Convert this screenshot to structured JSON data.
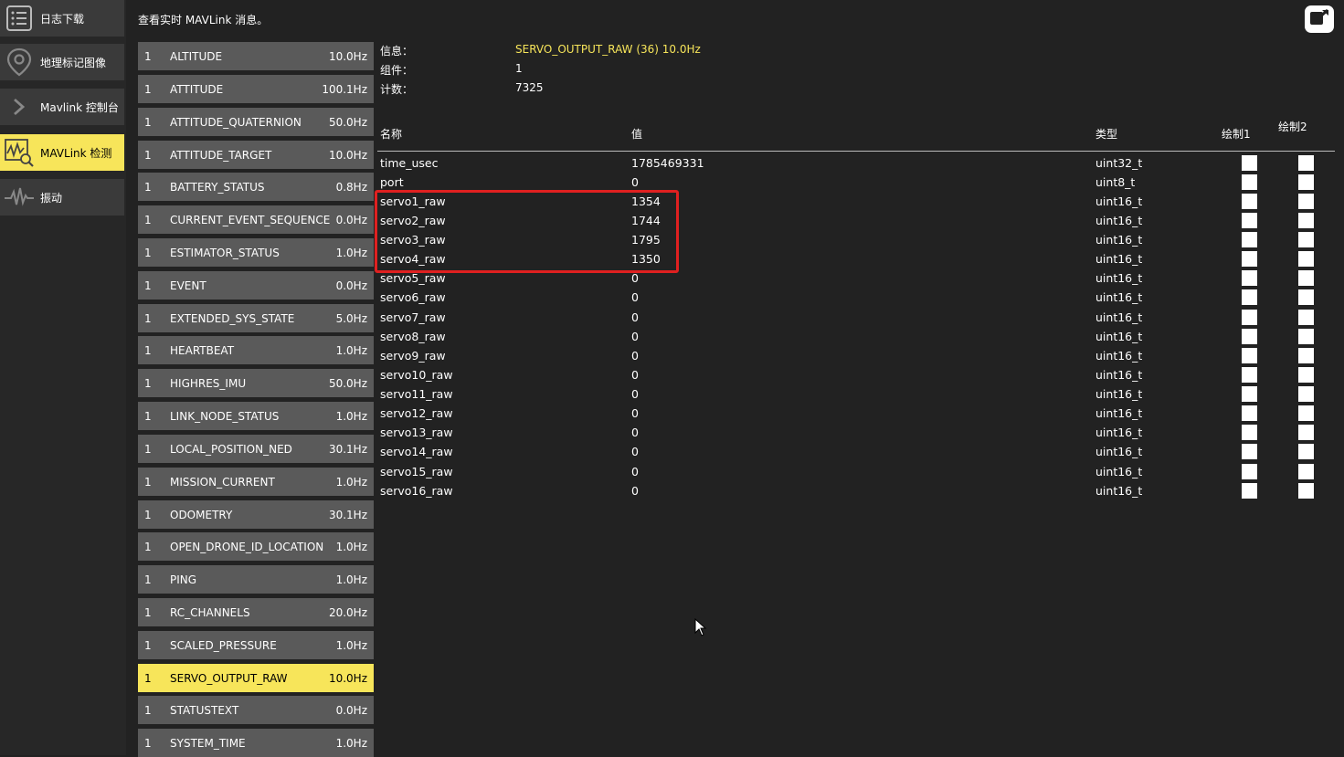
{
  "sidebar": {
    "items": [
      {
        "label": "日志下载",
        "icon": "list-icon",
        "active": false
      },
      {
        "label": "地理标记图像",
        "icon": "map-pin-icon",
        "active": false
      },
      {
        "label": "Mavlink 控制台",
        "icon": "chevron-right-icon",
        "active": false
      },
      {
        "label": "MAVLink 检测",
        "icon": "waveform-search-icon",
        "active": true
      },
      {
        "label": "振动",
        "icon": "vibration-wave-icon",
        "active": false
      }
    ]
  },
  "header": {
    "text": "查看实时 MAVLink 消息。",
    "popout_icon": "popout-window-icon"
  },
  "messages": [
    {
      "comp": "1",
      "name": "ALTITUDE",
      "rate": "10.0Hz"
    },
    {
      "comp": "1",
      "name": "ATTITUDE",
      "rate": "100.1Hz"
    },
    {
      "comp": "1",
      "name": "ATTITUDE_QUATERNION",
      "rate": "50.0Hz"
    },
    {
      "comp": "1",
      "name": "ATTITUDE_TARGET",
      "rate": "10.0Hz"
    },
    {
      "comp": "1",
      "name": "BATTERY_STATUS",
      "rate": "0.8Hz"
    },
    {
      "comp": "1",
      "name": "CURRENT_EVENT_SEQUENCE",
      "rate": "0.0Hz"
    },
    {
      "comp": "1",
      "name": "ESTIMATOR_STATUS",
      "rate": "1.0Hz"
    },
    {
      "comp": "1",
      "name": "EVENT",
      "rate": "0.0Hz"
    },
    {
      "comp": "1",
      "name": "EXTENDED_SYS_STATE",
      "rate": "5.0Hz"
    },
    {
      "comp": "1",
      "name": "HEARTBEAT",
      "rate": "1.0Hz"
    },
    {
      "comp": "1",
      "name": "HIGHRES_IMU",
      "rate": "50.0Hz"
    },
    {
      "comp": "1",
      "name": "LINK_NODE_STATUS",
      "rate": "1.0Hz"
    },
    {
      "comp": "1",
      "name": "LOCAL_POSITION_NED",
      "rate": "30.1Hz"
    },
    {
      "comp": "1",
      "name": "MISSION_CURRENT",
      "rate": "1.0Hz"
    },
    {
      "comp": "1",
      "name": "ODOMETRY",
      "rate": "30.1Hz"
    },
    {
      "comp": "1",
      "name": "OPEN_DRONE_ID_LOCATION",
      "rate": "1.0Hz"
    },
    {
      "comp": "1",
      "name": "PING",
      "rate": "1.0Hz"
    },
    {
      "comp": "1",
      "name": "RC_CHANNELS",
      "rate": "20.0Hz"
    },
    {
      "comp": "1",
      "name": "SCALED_PRESSURE",
      "rate": "1.0Hz"
    },
    {
      "comp": "1",
      "name": "SERVO_OUTPUT_RAW",
      "rate": "10.0Hz",
      "selected": true
    },
    {
      "comp": "1",
      "name": "STATUSTEXT",
      "rate": "0.0Hz"
    },
    {
      "comp": "1",
      "name": "SYSTEM_TIME",
      "rate": "1.0Hz"
    }
  ],
  "info": {
    "message_label": "信息：",
    "message_value": "SERVO_OUTPUT_RAW (36) 10.0Hz",
    "component_label": "组件：",
    "component_value": "1",
    "count_label": "计数：",
    "count_value": "7325"
  },
  "table": {
    "headers": {
      "name": "名称",
      "value": "值",
      "type": "类型",
      "plot1": "绘制1",
      "plot2": "绘制2"
    },
    "rows": [
      {
        "name": "time_usec",
        "value": "1785469331",
        "type": "uint32_t"
      },
      {
        "name": "port",
        "value": "0",
        "type": "uint8_t"
      },
      {
        "name": "servo1_raw",
        "value": "1354",
        "type": "uint16_t"
      },
      {
        "name": "servo2_raw",
        "value": "1744",
        "type": "uint16_t"
      },
      {
        "name": "servo3_raw",
        "value": "1795",
        "type": "uint16_t"
      },
      {
        "name": "servo4_raw",
        "value": "1350",
        "type": "uint16_t"
      },
      {
        "name": "servo5_raw",
        "value": "0",
        "type": "uint16_t"
      },
      {
        "name": "servo6_raw",
        "value": "0",
        "type": "uint16_t"
      },
      {
        "name": "servo7_raw",
        "value": "0",
        "type": "uint16_t"
      },
      {
        "name": "servo8_raw",
        "value": "0",
        "type": "uint16_t"
      },
      {
        "name": "servo9_raw",
        "value": "0",
        "type": "uint16_t"
      },
      {
        "name": "servo10_raw",
        "value": "0",
        "type": "uint16_t"
      },
      {
        "name": "servo11_raw",
        "value": "0",
        "type": "uint16_t"
      },
      {
        "name": "servo12_raw",
        "value": "0",
        "type": "uint16_t"
      },
      {
        "name": "servo13_raw",
        "value": "0",
        "type": "uint16_t"
      },
      {
        "name": "servo14_raw",
        "value": "0",
        "type": "uint16_t"
      },
      {
        "name": "servo15_raw",
        "value": "0",
        "type": "uint16_t"
      },
      {
        "name": "servo16_raw",
        "value": "0",
        "type": "uint16_t"
      }
    ]
  },
  "colors": {
    "background": "#222222",
    "sidebar": "#272727",
    "button": "#3a3a3a",
    "message_row": "#5a5a5a",
    "selected": "#f7e55a",
    "accent_text": "#f7e55a",
    "highlight_box": "#e02020"
  }
}
